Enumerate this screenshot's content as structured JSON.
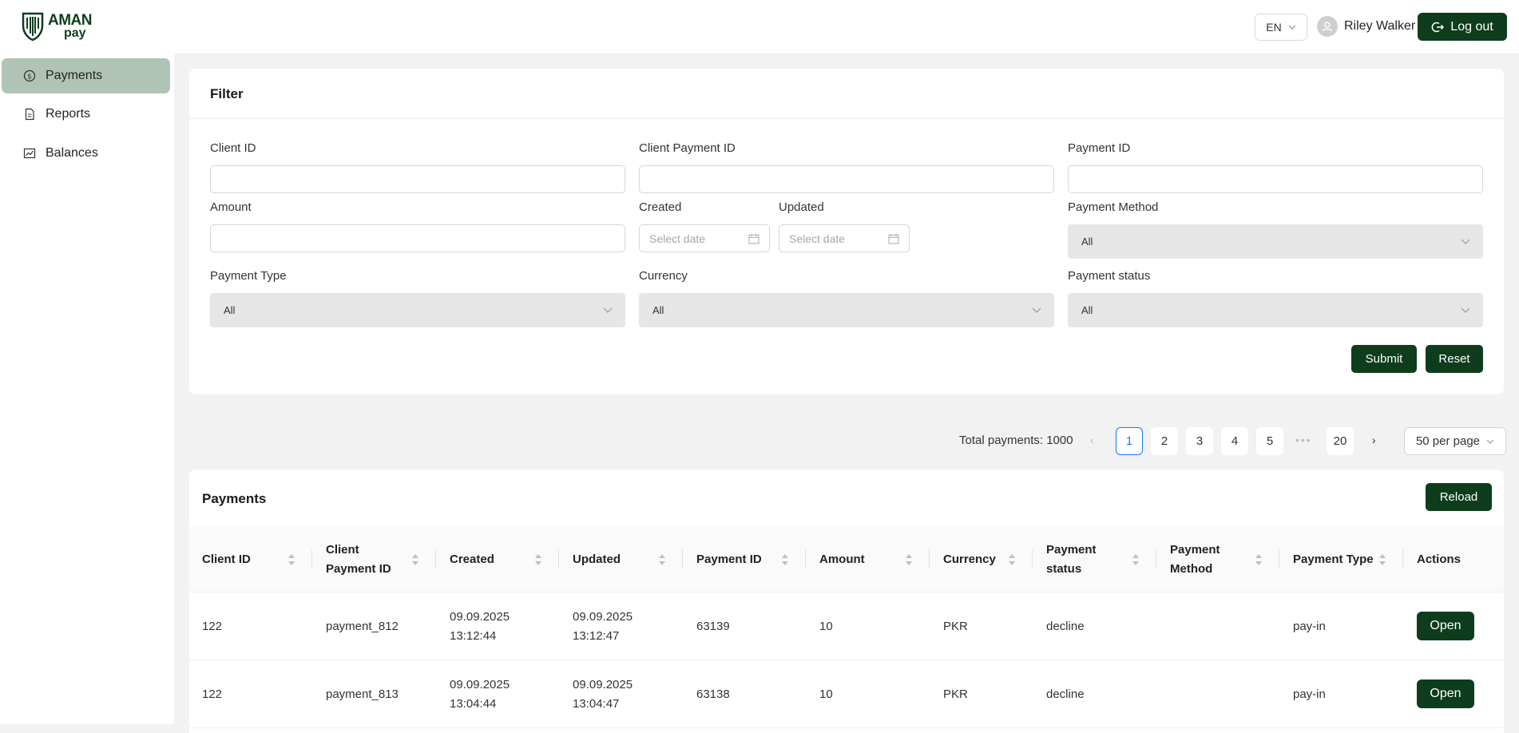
{
  "brand": {
    "name_line1": "AMAN",
    "name_line2": "pay"
  },
  "header": {
    "language": "EN",
    "user_name": "Riley Walker",
    "logout_label": "Log out"
  },
  "sidebar": {
    "items": [
      {
        "label": "Payments",
        "icon": "dollar-circle-icon",
        "active": true
      },
      {
        "label": "Reports",
        "icon": "document-icon",
        "active": false
      },
      {
        "label": "Balances",
        "icon": "chart-icon",
        "active": false
      }
    ]
  },
  "filter": {
    "title": "Filter",
    "fields": {
      "client_id": {
        "label": "Client ID",
        "value": ""
      },
      "client_payment_id": {
        "label": "Client Payment ID",
        "value": ""
      },
      "payment_id": {
        "label": "Payment ID",
        "value": ""
      },
      "amount": {
        "label": "Amount",
        "value": ""
      },
      "created": {
        "label": "Created",
        "placeholder": "Select date"
      },
      "updated": {
        "label": "Updated",
        "placeholder": "Select date"
      },
      "payment_method": {
        "label": "Payment Method",
        "value": "All"
      },
      "payment_type": {
        "label": "Payment Type",
        "value": "All"
      },
      "currency": {
        "label": "Currency",
        "value": "All"
      },
      "payment_status": {
        "label": "Payment status",
        "value": "All"
      }
    },
    "submit_label": "Submit",
    "reset_label": "Reset"
  },
  "pagination": {
    "total_text": "Total payments: 1000",
    "pages": [
      "1",
      "2",
      "3",
      "4",
      "5"
    ],
    "last_page": "20",
    "current": "1",
    "ellipsis": "•••",
    "per_page": "50 per page"
  },
  "payments_table": {
    "title": "Payments",
    "reload_label": "Reload",
    "columns": [
      {
        "line1": "Client ID",
        "line2": ""
      },
      {
        "line1": "Client",
        "line2": "Payment ID"
      },
      {
        "line1": "Created",
        "line2": ""
      },
      {
        "line1": "Updated",
        "line2": ""
      },
      {
        "line1": "Payment ID",
        "line2": ""
      },
      {
        "line1": "Amount",
        "line2": ""
      },
      {
        "line1": "Currency",
        "line2": ""
      },
      {
        "line1": "Payment",
        "line2": "status"
      },
      {
        "line1": "Payment",
        "line2": "Method"
      },
      {
        "line1": "Payment Type",
        "line2": ""
      },
      {
        "line1": "Actions",
        "line2": ""
      }
    ],
    "rows": [
      {
        "client_id": "122",
        "client_payment_id": "payment_812",
        "created_date": "09.09.2025",
        "created_time": "13:12:44",
        "updated_date": "09.09.2025",
        "updated_time": "13:12:47",
        "payment_id": "63139",
        "amount": "10",
        "currency": "PKR",
        "status": "decline",
        "method": "",
        "type": "pay-in",
        "action": "Open"
      },
      {
        "client_id": "122",
        "client_payment_id": "payment_813",
        "created_date": "09.09.2025",
        "created_time": "13:04:44",
        "updated_date": "09.09.2025",
        "updated_time": "13:04:47",
        "payment_id": "63138",
        "amount": "10",
        "currency": "PKR",
        "status": "decline",
        "method": "",
        "type": "pay-in",
        "action": "Open"
      }
    ]
  },
  "colors": {
    "primary_dark_green": "#0d3d1d",
    "sidebar_active": "#b0c4b5",
    "page_link_active": "#1677ff"
  }
}
